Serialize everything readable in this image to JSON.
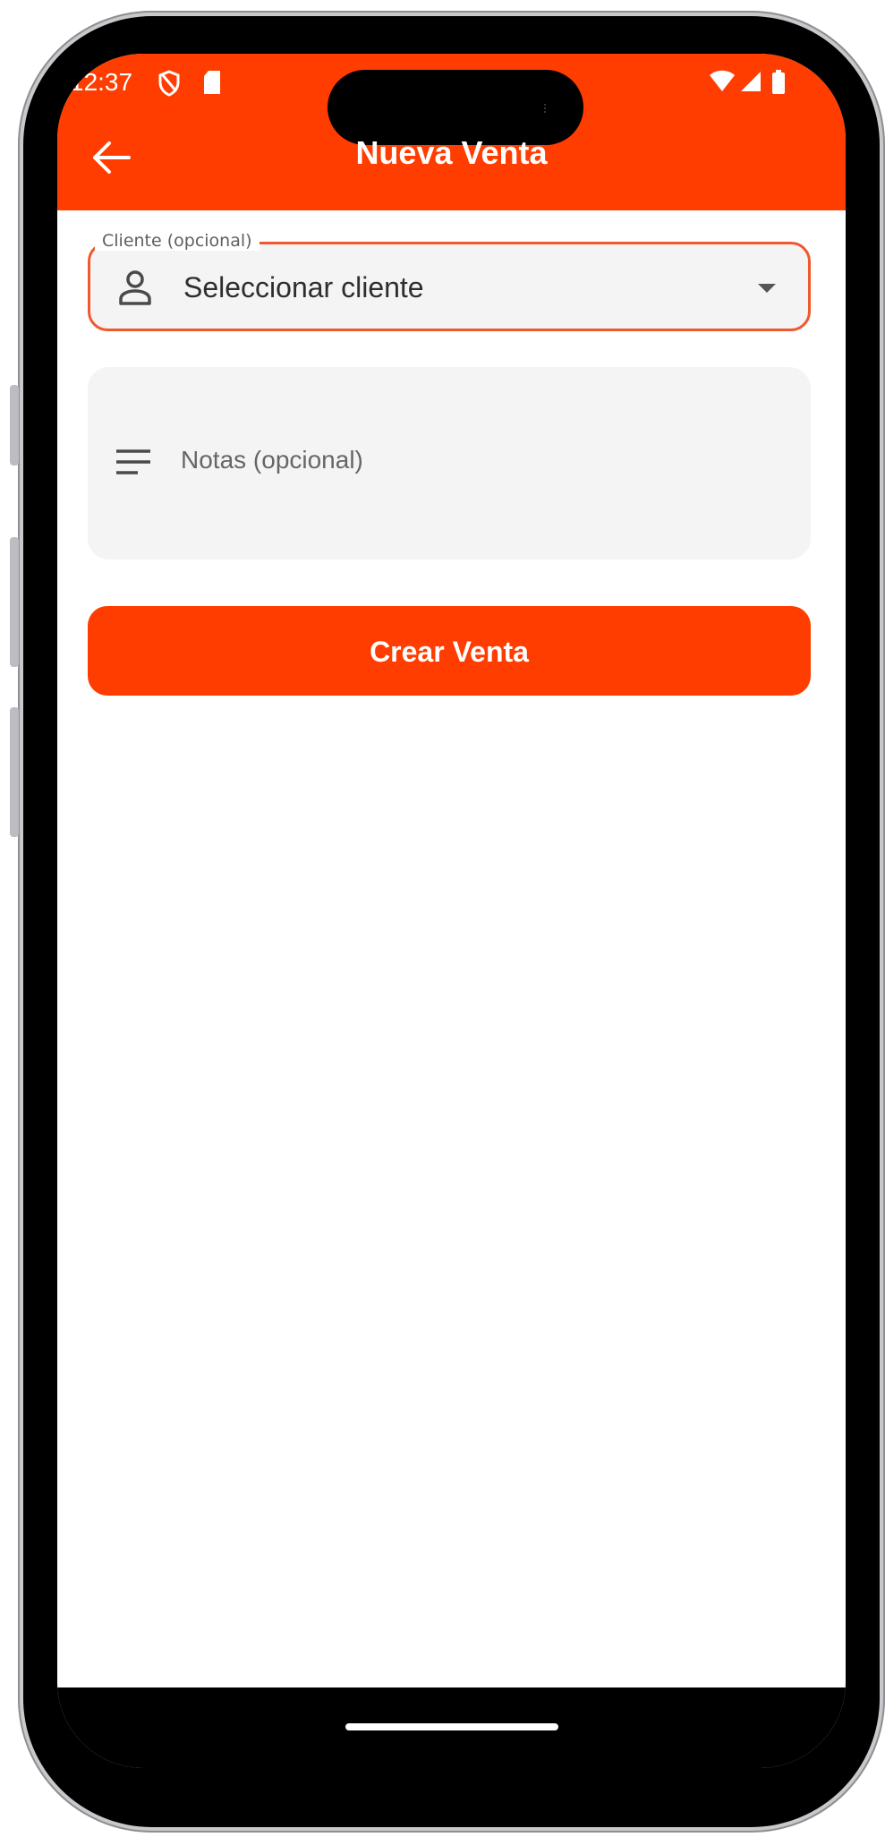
{
  "status_bar": {
    "time": "12:37",
    "icons": [
      "shield-icon",
      "sd-card-icon",
      "wifi-icon",
      "signal-icon",
      "battery-icon"
    ]
  },
  "app_bar": {
    "title": "Nueva Venta",
    "back_icon": "arrow-left-icon",
    "color": "#ff3d00"
  },
  "form": {
    "client_field": {
      "label": "Cliente (opcional)",
      "value": "Seleccionar cliente",
      "icon": "person-icon",
      "accent": "#f0582d"
    },
    "notes_field": {
      "placeholder": "Notas (opcional)",
      "icon": "notes-lines-icon"
    },
    "submit_label": "Crear Venta"
  }
}
